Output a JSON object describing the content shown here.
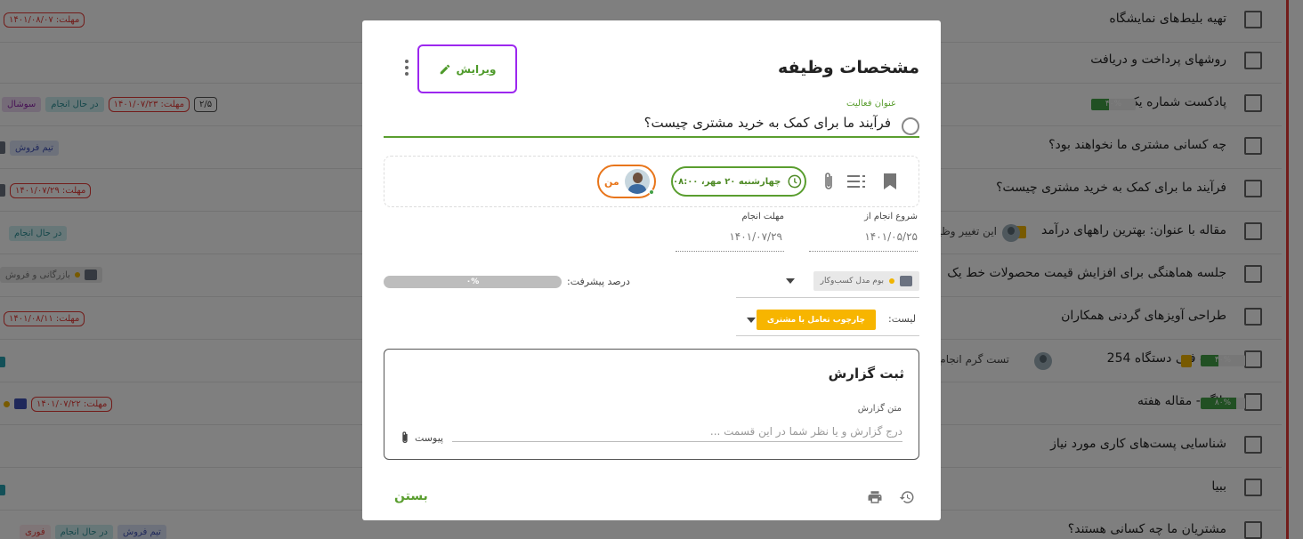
{
  "background_tasks": [
    {
      "title": "تهیه بلیط‌های نمایشگاه",
      "tags": [
        {
          "text": "مهلت: ۱۴۰۱/۰۸/۰۷",
          "type": "deadline"
        }
      ]
    },
    {
      "title": "روشهای پرداخت و دریافت",
      "tags": []
    },
    {
      "title": "پادکست شماره یک",
      "progress": "۴۰%",
      "tags": [
        {
          "text": "۲/۵",
          "type": "sub"
        },
        {
          "text": "مهلت: ۱۴۰۱/۰۷/۲۳",
          "type": "deadline"
        },
        {
          "text": "در حال انجام",
          "type": "teal"
        },
        {
          "text": "سوشال",
          "type": "purple"
        }
      ]
    },
    {
      "title": "چه کسانی مشتری ما نخواهند بود؟",
      "tags": [
        {
          "text": "تیم فروش",
          "type": "blue"
        }
      ]
    },
    {
      "title": "فرآیند ما برای کمک به خرید مشتری چیست؟",
      "tags": [
        {
          "text": "مهلت: ۱۴۰۱/۰۷/۲۹",
          "type": "deadline"
        }
      ]
    },
    {
      "title": "مقاله با عنوان: بهترین راههای درآمد",
      "extra": "این تغییر وظیفه رو",
      "tags": [
        {
          "text": "در حال انجام",
          "type": "teal"
        }
      ]
    },
    {
      "title": "جلسه هماهنگی برای افزایش قیمت محصولات خط یک",
      "tags": [
        {
          "text": "بازرگانی و فروش",
          "type": "grey"
        }
      ]
    },
    {
      "title": "طراحی آویزهای گردنی همکاران",
      "tags": [
        {
          "text": "مهلت: ۱۴۰۱/۰۸/۱۱",
          "type": "deadline"
        }
      ]
    },
    {
      "title": "تست فنی دستگاه 254",
      "progress": "۴۰%",
      "extra": "تست گرم انجام شد",
      "tags": []
    },
    {
      "title": "بلاگ - مقاله هفته",
      "progress": "۸۰%",
      "tags": [
        {
          "text": "مهلت: ۱۴۰۱/۰۷/۲۲",
          "type": "deadline"
        }
      ]
    },
    {
      "title": "شناسایی پست‌های کاری مورد نیاز",
      "tags": []
    },
    {
      "title": "ببیا",
      "tags": []
    },
    {
      "title": "مشتریان ما چه کسانی هستند؟",
      "tags": [
        {
          "text": "تیم فروش",
          "type": "blue"
        },
        {
          "text": "در حال انجام",
          "type": "teal"
        },
        {
          "text": "فوری",
          "type": "orange"
        }
      ]
    }
  ],
  "modal": {
    "title": "مشخصات وظیفه",
    "edit_label": "ویرایش",
    "activity_title_label": "عنوان فعالیت",
    "task_title": "فرآیند ما برای کمک به خرید مشتری چیست؟",
    "due_datetime": "چهارشنبه ۲۰ مهر، ۰۸:۰۰",
    "assignee_label": "من",
    "start_label": "شروع انجام از",
    "start_date": "۱۴۰۱/۰۵/۲۵",
    "deadline_label": "مهلت انجام",
    "deadline_date": "۱۴۰۱/۰۷/۲۹",
    "model_chip": "بوم مدل کسب‌وکار",
    "progress_label": "درصد پیشرفت:",
    "progress_value": 0,
    "progress_text": "۰%",
    "list_label": "لیست:",
    "list_value": "چارچوب تعامل با مشتری",
    "report_title": "ثبت گزارش",
    "report_label": "متن گزارش",
    "report_placeholder": "درج گزارش و یا نظر شما در این قسمت ...",
    "attach_label": "پیوست",
    "close_label": "بستن"
  },
  "colors": {
    "accent_green": "#5a9e2f",
    "edit_border": "#9c27ef",
    "assignee_orange": "#e8751a",
    "list_yellow": "#f7b500",
    "deadline_red": "#e53935"
  },
  "icons": [
    "pencil-icon",
    "kebab-menu-icon",
    "bookmark-icon",
    "checklist-icon",
    "attachment-icon",
    "clock-icon",
    "history-icon",
    "print-icon"
  ]
}
